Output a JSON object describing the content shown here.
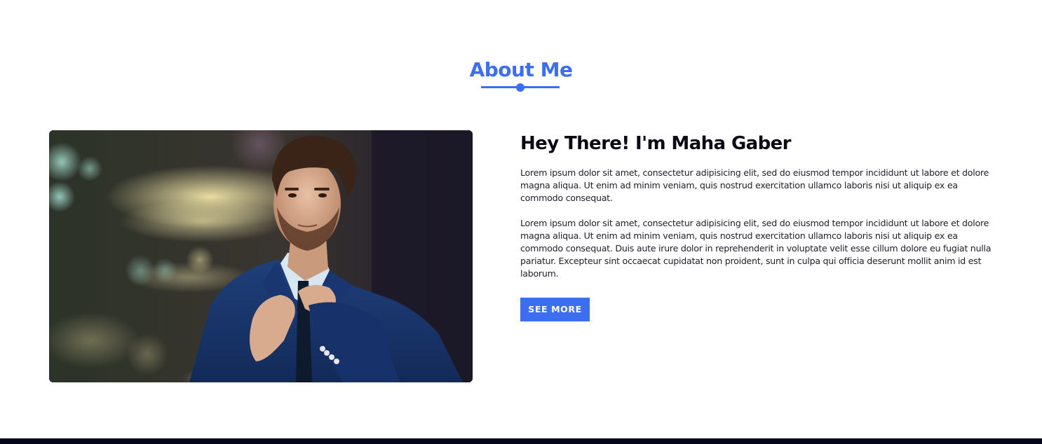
{
  "section": {
    "title": "About Me"
  },
  "about": {
    "headline": "Hey There! I'm Maha Gaber",
    "paragraph_1": "Lorem ipsum dolor sit amet, consectetur adipisicing elit, sed do eiusmod tempor incididunt ut labore et dolore magna aliqua. Ut enim ad minim veniam, quis nostrud exercitation ullamco laboris nisi ut aliquip ex ea commodo consequat.",
    "paragraph_2": "Lorem ipsum dolor sit amet, consectetur adipisicing elit, sed do eiusmod tempor incididunt ut labore et dolore magna aliqua. Ut enim ad minim veniam, quis nostrud exercitation ullamco laboris nisi ut aliquip ex ea commodo consequat. Duis aute irure dolor in reprehenderit in voluptate velit esse cillum dolore eu fugiat nulla pariatur. Excepteur sint occaecat cupidatat non proident, sunt in culpa qui officia deserunt mollit anim id est laborum.",
    "button_label": "SEE MORE"
  },
  "colors": {
    "accent": "#3d6ef0",
    "text": "#0a0a14",
    "footer": "#05061a"
  }
}
